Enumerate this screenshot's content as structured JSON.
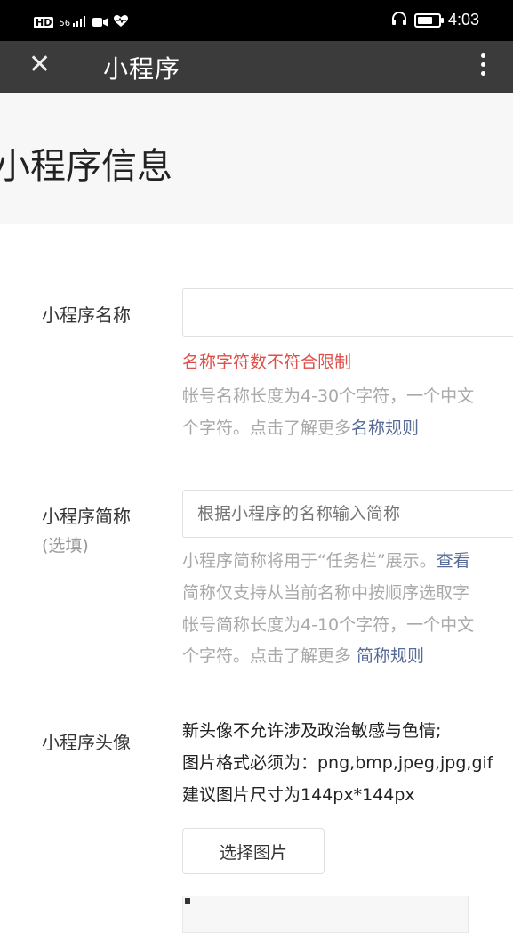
{
  "status_bar": {
    "hd_badge": "HD",
    "signal_text": "56",
    "time": "4:03",
    "battery_level": 0.8
  },
  "title_bar": {
    "close_icon": "close-icon",
    "title": "小程序",
    "more_icon": "kebab-icon"
  },
  "page": {
    "title": "小程序信息"
  },
  "name_field": {
    "label": "小程序名称",
    "value": "",
    "error": "名称字符数不符合限制",
    "help_line1": "帐号名称长度为4-30个字符，一个中文",
    "help_line2_text": "个字符。点击了解更多",
    "help_line2_link": "名称规则"
  },
  "short_name_field": {
    "label": "小程序简称",
    "sublabel": "(选填)",
    "placeholder": "根据小程序的名称输入简称",
    "help_line1_text": "小程序简称将用于“任务栏”展示。",
    "help_line1_link": "查看",
    "help_line2": "简称仅支持从当前名称中按顺序选取字",
    "help_line3": "帐号简称长度为4-10个字符，一个中文",
    "help_line4_text": "个字符。点击了解更多 ",
    "help_line4_link": "简称规则"
  },
  "avatar_field": {
    "label": "小程序头像",
    "rule1": "新头像不允许涉及政治敏感与色情;",
    "rule2": "图片格式必须为：png,bmp,jpeg,jpg,gif",
    "rule3": "建议图片尺寸为144px*144px",
    "button": "选择图片"
  }
}
